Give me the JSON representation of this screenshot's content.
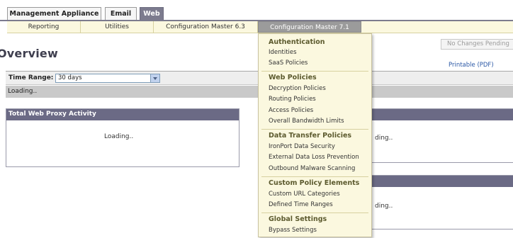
{
  "top_tabs": [
    {
      "label": "Management Appliance"
    },
    {
      "label": "Email"
    },
    {
      "label": "Web"
    }
  ],
  "subnav": [
    {
      "label": "Reporting"
    },
    {
      "label": "Utilities"
    },
    {
      "label": "Configuration Master 6.3"
    },
    {
      "label": "Configuration Master 7.1"
    }
  ],
  "page": {
    "title": "Overview",
    "no_changes_label": "No Changes Pending",
    "printable_label": "Printable (PDF)"
  },
  "time_range": {
    "label": "Time Range:",
    "value": "30 days",
    "loading": "Loading.."
  },
  "panels": {
    "total_web_proxy": {
      "title": "Total Web Proxy Activity",
      "loading": "Loading.."
    },
    "right_top": {
      "loading": "ding.."
    },
    "right_bottom": {
      "loading": "ding.."
    }
  },
  "menu": {
    "sections": [
      {
        "heading": "Authentication",
        "items": [
          "Identities",
          "SaaS Policies"
        ]
      },
      {
        "heading": "Web Policies",
        "items": [
          "Decryption Policies",
          "Routing Policies",
          "Access Policies",
          "Overall Bandwidth Limits"
        ]
      },
      {
        "heading": "Data Transfer Policies",
        "items": [
          "IronPort Data Security",
          "External Data Loss Prevention",
          "Outbound Malware Scanning"
        ]
      },
      {
        "heading": "Custom Policy Elements",
        "items": [
          "Custom URL Categories",
          "Defined Time Ranges"
        ]
      },
      {
        "heading": "Global Settings",
        "items": [
          "Bypass Settings"
        ]
      }
    ]
  },
  "colors": {
    "tab_active": "#7c7b8e",
    "panel_header": "#6b6a85",
    "menu_bg": "#fbf8df",
    "link": "#2b58a6"
  }
}
